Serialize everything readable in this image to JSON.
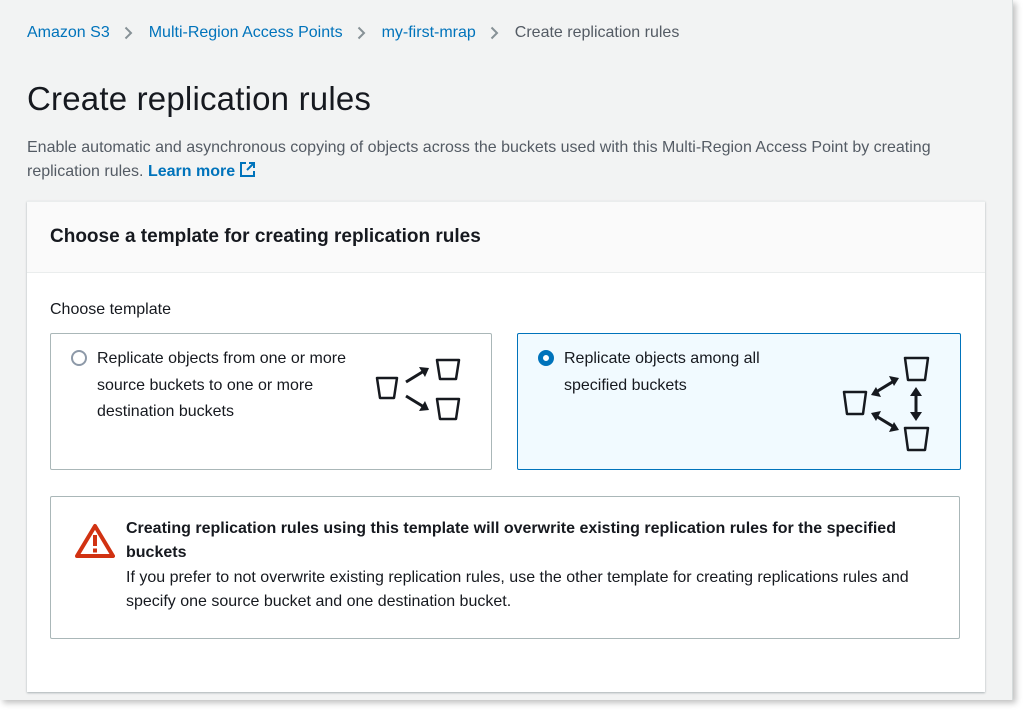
{
  "breadcrumb": {
    "items": [
      "Amazon S3",
      "Multi-Region Access Points",
      "my-first-mrap"
    ],
    "current": "Create replication rules"
  },
  "page": {
    "title": "Create replication rules",
    "description": "Enable automatic and asynchronous copying of objects across the buckets used with this Multi-Region Access Point by creating replication rules.",
    "learn_more": "Learn more"
  },
  "card": {
    "title": "Choose a template for creating replication rules",
    "field_label": "Choose template",
    "options": [
      {
        "label": "Replicate objects from one or more source buckets to one or more destination buckets",
        "selected": false,
        "icon": "one-to-many-buckets-icon"
      },
      {
        "label": "Replicate objects among all specified buckets",
        "selected": true,
        "icon": "bidirectional-buckets-icon"
      }
    ]
  },
  "alert": {
    "type": "warning",
    "icon": "warning-icon",
    "title": "Creating replication rules using this template will overwrite existing replication rules for the specified buckets",
    "body": "If you prefer to not overwrite existing replication rules, use the other template for creating replications rules and specify one source bucket and one destination bucket."
  },
  "colors": {
    "link": "#0073bb",
    "selected_tile_bg": "#f1faff",
    "warning": "#d13212",
    "background": "#f2f3f3"
  }
}
